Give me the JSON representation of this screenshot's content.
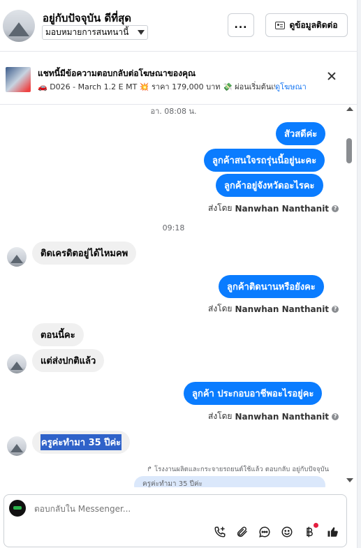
{
  "header": {
    "contact_name": "อยู่กับปัจจุบัน ดีที่สุด",
    "assign_select_value": "มอบหมายการสนทนานี้",
    "more_label": "...",
    "contact_info_label": "ดูข้อมูลติดต่อ"
  },
  "ad_banner": {
    "title": "แชทนี้มีข้อความตอบกลับต่อโฆษณาของคุณ",
    "details": "🚗 D026 - March 1.2 E MT 💥 ราคา 179,000 บาท 💸 ผ่อนเริ่มต้นเพียง ...",
    "view_ad_label": "ดูโฆษณา"
  },
  "chat": {
    "timestamp_1": "อา. 08:08 น.",
    "timestamp_2": "09:18",
    "out_msg_1": "สัวสดีค่ะ",
    "out_msg_2": "ลูกค้าสนใจรถรุ่นนี้อยู่นะคะ",
    "out_msg_3": "ลูกค้าอยู่จังหวัดอะไรคะ",
    "in_msg_1": "ติดเครดิตอยู่ได้ไหมคพ",
    "out_msg_4": "ลูกค้าติดนานหรือยังคะ",
    "in_msg_2": "ตอนนี้คะ",
    "in_msg_3": "แต่ส่งปกติแล้ว",
    "out_msg_5": "ลูกค้า ประกอบอาชีพอะไรอยู่คะ",
    "in_msg_4": "ครูค่ะทำมา 35 ปีค่ะ",
    "sent_by_prefix": "ส่งโดย",
    "sent_by_name": "Nanwhan Nanthanit",
    "reply_note": "↱ โรงงานผลิตและกระจายรถยนต์ใช้แล้ว ตอบกลับ อยู่กับปัจจุบัน",
    "reply_preview": "ครูค่ะทำมา 35 ปีค่ะ"
  },
  "composer": {
    "placeholder": "ตอบกลับใน Messenger..."
  },
  "icons": {
    "add_call": "phone-plus-icon",
    "attach": "paperclip-icon",
    "saved_replies": "chat-bubble-icon",
    "emoji": "smile-icon",
    "payment": "baht-icon",
    "like": "thumbs-up-icon"
  },
  "colors": {
    "outgoing_bubble": "#0a7cff",
    "incoming_bubble": "#f0f0f0",
    "link": "#1877f2",
    "notification_dot": "#e41e3f"
  }
}
